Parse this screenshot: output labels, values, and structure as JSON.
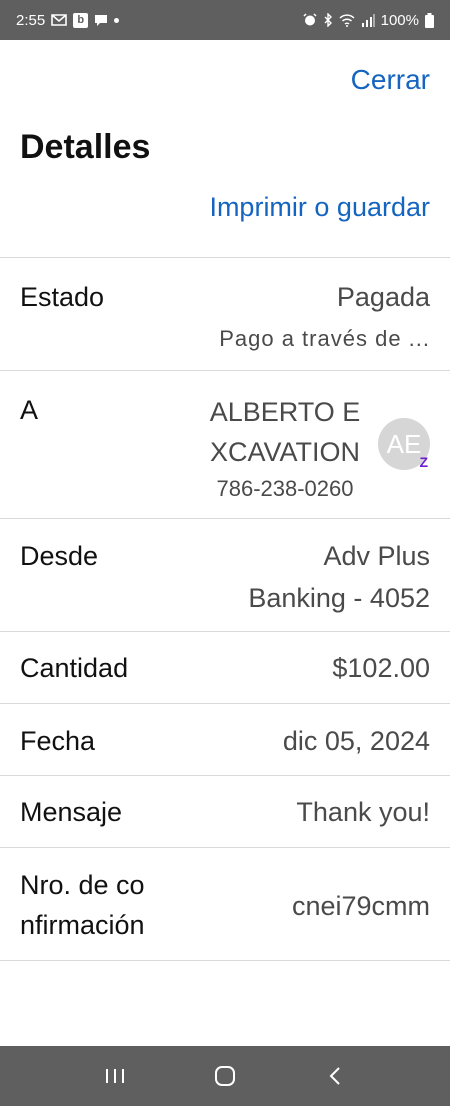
{
  "status_bar": {
    "time": "2:55",
    "battery": "100%",
    "left_icons": [
      "gmail-icon",
      "b-app-icon",
      "chat-icon",
      "dot-icon"
    ],
    "right_icons": [
      "alarm-icon",
      "bluetooth-icon",
      "wifi-icon",
      "signal-icon",
      "battery-icon"
    ]
  },
  "header": {
    "close": "Cerrar",
    "title": "Detalles",
    "print": "Imprimir o guardar"
  },
  "details": {
    "estado_label": "Estado",
    "estado_value": "Pagada",
    "estado_sub": "Pago a través de ...",
    "to_label": "A",
    "to_name_line1": "ALBERTO E",
    "to_name_line2": "XCAVATION",
    "to_phone": "786-238-0260",
    "to_avatar": "AE",
    "to_badge": "Z",
    "from_label": "Desde",
    "from_line1": "Adv Plus",
    "from_line2": "Banking - 4052",
    "amount_label": "Cantidad",
    "amount_value": "$102.00",
    "date_label": "Fecha",
    "date_value": "dic 05, 2024",
    "message_label": "Mensaje",
    "message_value": "Thank you!",
    "confirmation_label_line1": "Nro. de co",
    "confirmation_label_line2": "nfirmación",
    "confirmation_value": "cnei79cmm"
  },
  "nav_bar": {
    "buttons": [
      "recent-apps-icon",
      "home-icon",
      "back-icon"
    ]
  },
  "colors": {
    "link": "#1565c0",
    "system_bar": "#5f5f5f",
    "zelle": "#6d1ed4"
  }
}
